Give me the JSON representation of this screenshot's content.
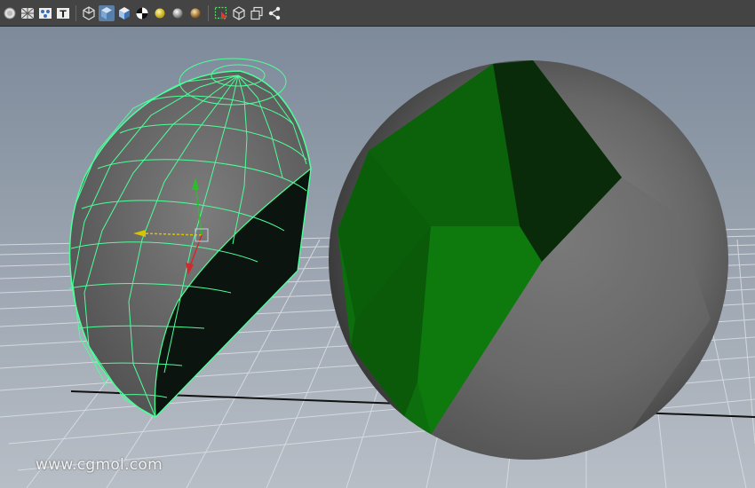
{
  "toolbar": {
    "icons": [
      {
        "name": "circle-select-icon"
      },
      {
        "name": "wireframe-grid-icon"
      },
      {
        "name": "texture-nodes-icon"
      },
      {
        "name": "text-t-icon",
        "label": "T"
      },
      {
        "name": "wireframe-cube-icon"
      },
      {
        "name": "shaded-cube-icon"
      },
      {
        "name": "textured-cube-icon"
      },
      {
        "name": "checker-ball-icon"
      },
      {
        "name": "default-light-icon"
      },
      {
        "name": "gray-sphere-icon"
      },
      {
        "name": "bronze-sphere-icon"
      },
      {
        "name": "isolate-select-icon"
      },
      {
        "name": "xray-cube-icon"
      },
      {
        "name": "multi-cube-icon"
      },
      {
        "name": "share-nodes-icon"
      }
    ]
  },
  "viewport": {
    "background_top": "#7e8a99",
    "background_bottom": "#b5bcc5",
    "wire_color": "#4dff9a",
    "green_shade": "#0c7a0c",
    "dark_green_shade": "#0a2a0a"
  },
  "watermark": "www.cgmol.com"
}
